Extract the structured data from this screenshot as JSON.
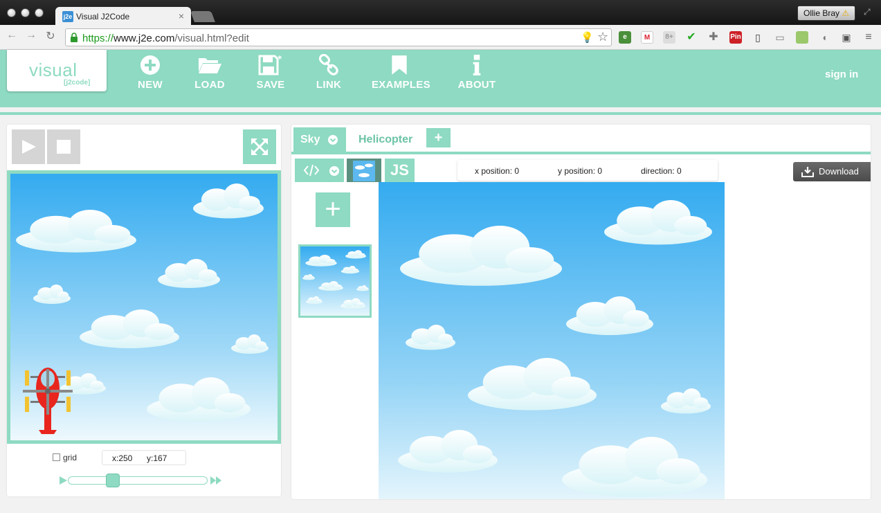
{
  "browser": {
    "tab_title": "Visual J2Code",
    "tab_favicon_text": "j2e",
    "user_name": "Ollie Bray",
    "url_scheme": "https://",
    "url_host": "www.j2e.com",
    "url_path": "/visual.html?edit",
    "pin_badge": "Pin",
    "gplus_text": "8+"
  },
  "app": {
    "logo_word": "visual",
    "logo_sub": "[j2code]",
    "menu": [
      {
        "label": "NEW",
        "icon": "plus-circle-icon"
      },
      {
        "label": "LOAD",
        "icon": "folder-open-icon"
      },
      {
        "label": "SAVE",
        "icon": "save-icon"
      },
      {
        "label": "LINK",
        "icon": "link-icon"
      },
      {
        "label": "EXAMPLES",
        "icon": "bookmark-icon"
      },
      {
        "label": "ABOUT",
        "icon": "info-icon"
      }
    ],
    "signin": "sign in",
    "accent_color": "#8edac2"
  },
  "player": {
    "grid_label": "grid",
    "x_readout": "x:250",
    "y_readout": "y:167",
    "slider_fraction": 0.3
  },
  "editor": {
    "sprite_tabs": [
      {
        "label": "Sky",
        "active": true
      },
      {
        "label": "Helicopter",
        "active": false
      }
    ],
    "add_sprite": "+",
    "mode_js": "JS",
    "add_costume": "+",
    "status": {
      "x": "x position: 0",
      "y": "y position: 0",
      "direction": "direction: 0"
    },
    "download": "Download"
  }
}
